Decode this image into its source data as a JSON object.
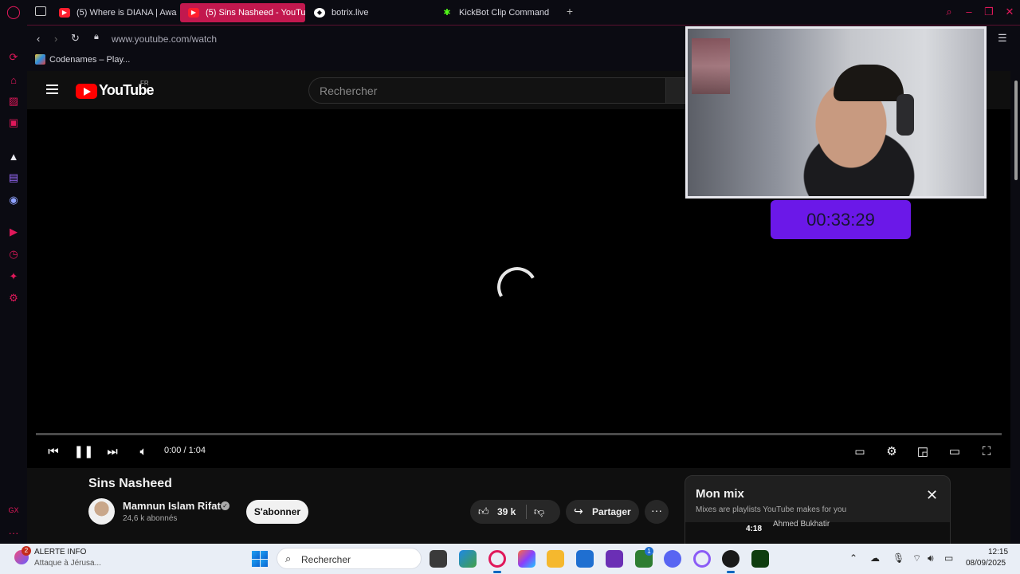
{
  "browser": {
    "tabs": [
      {
        "label": "(5) Where is DIANA | Awa",
        "icon": "youtube-icon"
      },
      {
        "label": "(5) Sins Nasheed - YouTu",
        "icon": "youtube-icon",
        "active": true
      },
      {
        "label": "botrix.live",
        "icon": "botrix-icon"
      },
      {
        "label": "KickBot Clip Command",
        "icon": "kickbot-icon"
      }
    ],
    "url": "www.youtube.com/watch",
    "bookmark": "Codenames – Play...",
    "accent_color": "#c2184e"
  },
  "youtube": {
    "logo_text": "YouTube",
    "country_code": "FR",
    "search_placeholder": "Rechercher",
    "player": {
      "time": "0:00 / 1:04",
      "progress": 0
    },
    "video_title": "Sins Nasheed",
    "channel_name": "Mamnun Islam Rifat",
    "subscribers": "24,6 k abonnés",
    "subscribe_label": "S'abonner",
    "likes": "39 k",
    "share_label": "Partager",
    "mix": {
      "title": "Mon mix",
      "subtitle": "Mixes are playlists YouTube makes for you",
      "first_item_duration": "4:18",
      "first_item_artist": "Ahmed Bukhatir"
    }
  },
  "overlay": {
    "timer": "00:33:29",
    "timer_color": "#6b18e8"
  },
  "taskbar": {
    "news_badge": "2",
    "news_title": "ALERTE INFO",
    "news_subtitle": "Attaque à Jérusa...",
    "search_placeholder": "Rechercher",
    "teams_badge": "1",
    "time": "12:15",
    "date": "08/09/2025"
  }
}
